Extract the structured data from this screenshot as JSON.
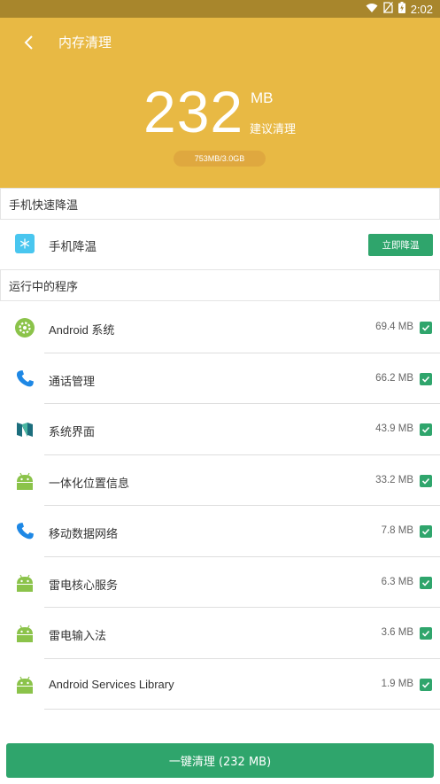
{
  "status_bar": {
    "time": "2:02"
  },
  "header": {
    "title": "内存清理",
    "amount": "232",
    "unit": "MB",
    "suggest_label": "建议清理",
    "usage": "753MB/3.0GB"
  },
  "cooling": {
    "section_title": "手机快速降温",
    "item_label": "手机降温",
    "button_label": "立即降温"
  },
  "running": {
    "section_title": "运行中的程序",
    "apps": [
      {
        "name": "Android 系统",
        "size": "69.4 MB",
        "icon": "android-settings-icon",
        "checked": true
      },
      {
        "name": "通话管理",
        "size": "66.2 MB",
        "icon": "phone-icon",
        "checked": true
      },
      {
        "name": "系统界面",
        "size": "43.9 MB",
        "icon": "nougat-logo-icon",
        "checked": true
      },
      {
        "name": "一体化位置信息",
        "size": "33.2 MB",
        "icon": "android-robot-icon",
        "checked": true
      },
      {
        "name": "移动数据网络",
        "size": "7.8 MB",
        "icon": "phone-icon",
        "checked": true
      },
      {
        "name": "雷电核心服务",
        "size": "6.3 MB",
        "icon": "android-robot-icon",
        "checked": true
      },
      {
        "name": "雷电输入法",
        "size": "3.6 MB",
        "icon": "android-robot-icon",
        "checked": true
      },
      {
        "name": "Android Services Library",
        "size": "1.9 MB",
        "icon": "android-robot-icon",
        "checked": true
      }
    ]
  },
  "footer": {
    "clean_button": "一键清理 (232 MB)"
  },
  "colors": {
    "header": "#e8b944",
    "status_bar": "#a8862c",
    "accent_green": "#2fa56c",
    "cool_icon": "#49c6ef"
  }
}
